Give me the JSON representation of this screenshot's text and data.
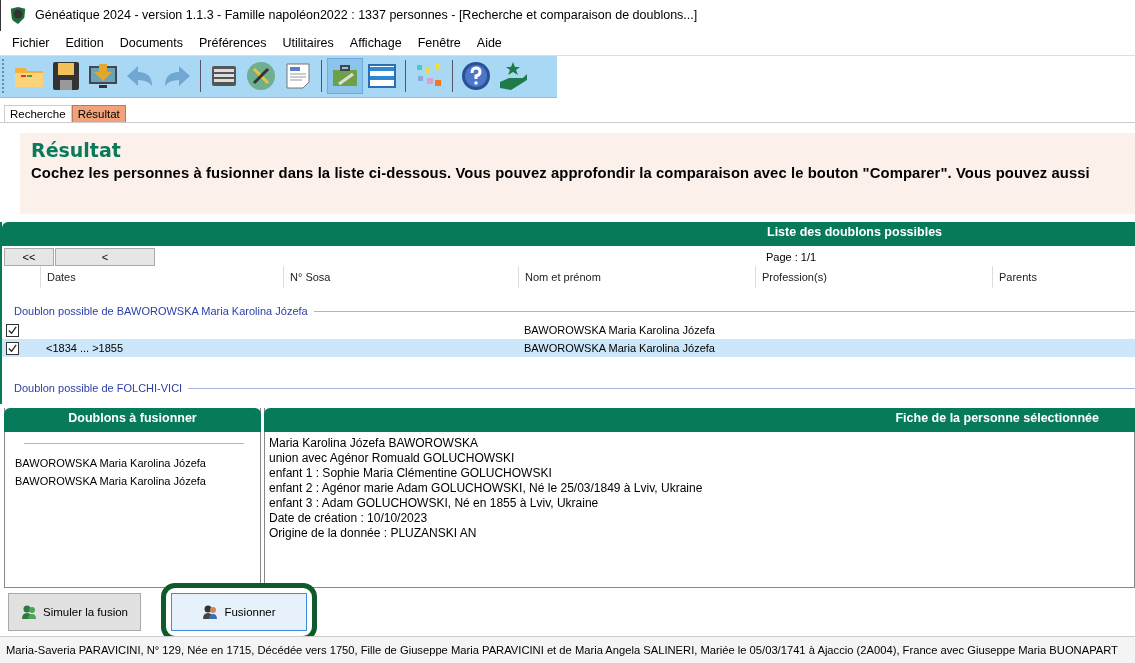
{
  "window": {
    "title": "Généatique 2024 - version 1.1.3 - Famille napoléon2022 : 1337 personnes - [Recherche et comparaison de doublons...]"
  },
  "menu": [
    "Fichier",
    "Edition",
    "Documents",
    "Préférences",
    "Utilitaires",
    "Affichage",
    "Fenêtre",
    "Aide"
  ],
  "toolbar": [
    {
      "kind": "folder",
      "disabled": false,
      "selected": false
    },
    {
      "kind": "save",
      "disabled": false,
      "selected": false
    },
    {
      "kind": "import",
      "disabled": false,
      "selected": false
    },
    {
      "kind": "undo",
      "disabled": true,
      "selected": false
    },
    {
      "kind": "redo",
      "disabled": true,
      "selected": false
    },
    {
      "kind": "separator"
    },
    {
      "kind": "cards",
      "disabled": false,
      "selected": false
    },
    {
      "kind": "tools",
      "disabled": false,
      "selected": false
    },
    {
      "kind": "document",
      "disabled": false,
      "selected": false
    },
    {
      "kind": "separator"
    },
    {
      "kind": "toolbox",
      "disabled": false,
      "selected": true
    },
    {
      "kind": "windows",
      "disabled": false,
      "selected": false
    },
    {
      "kind": "separator"
    },
    {
      "kind": "mosaic",
      "disabled": false,
      "selected": false
    },
    {
      "kind": "separator"
    },
    {
      "kind": "help",
      "disabled": false,
      "selected": false
    },
    {
      "kind": "award",
      "disabled": false,
      "selected": false
    }
  ],
  "tabs": [
    {
      "label": "Recherche",
      "selected": false
    },
    {
      "label": "Résultat",
      "selected": true
    }
  ],
  "banner": {
    "title": "Résultat",
    "text": "Cochez les personnes à fusionner dans la liste ci-dessous.  Vous pouvez approfondir la comparaison avec le bouton  \"Comparer\".  Vous pouvez aussi"
  },
  "list": {
    "title": "Liste des doublons possibles",
    "nav": [
      "<<",
      "<"
    ],
    "page": "Page : 1/1",
    "columns": [
      "Dates",
      "N° Sosa",
      "Nom et prénom",
      "Profession(s)",
      "Parents"
    ],
    "groups": [
      {
        "label": "Doublon possible  de BAWOROWSKA Maria Karolina Józefa",
        "rows": [
          {
            "checked": true,
            "selected": false,
            "dates": "",
            "name": "BAWOROWSKA Maria Karolina Józefa"
          },
          {
            "checked": true,
            "selected": true,
            "dates": "<1834 ... >1855",
            "name": "BAWOROWSKA Maria Karolina Józefa"
          }
        ]
      },
      {
        "label": "Doublon possible  de FOLCHI-VICI"
      }
    ]
  },
  "merge_panel": {
    "title": "Doublons à fusionner",
    "items": [
      "BAWOROWSKA Maria Karolina Józefa",
      "BAWOROWSKA Maria Karolina Józefa"
    ]
  },
  "detail_panel": {
    "title": "Fiche de la personne sélectionnée",
    "lines": [
      "Maria Karolina Józefa BAWOROWSKA",
      "union  avec Agénor Romuald GOLUCHOWSKI",
      "enfant 1 : Sophie Maria Clémentine GOLUCHOWSKI",
      "enfant 2 : Agénor marie Adam GOLUCHOWSKI, Né le 25/03/1849 à Lviv, Ukraine",
      "enfant 3 : Adam GOLUCHOWSKI, Né en 1855 à Lviv, Ukraine",
      "Date de création : 10/10/2023",
      "Origine de la donnée : PLUZANSKI AN"
    ]
  },
  "buttons": [
    {
      "label": "Simuler la fusion",
      "kind": "simulate",
      "focused": false
    },
    {
      "label": "Fusionner",
      "kind": "merge",
      "focused": true
    }
  ],
  "status_bar": "Maria-Saveria PARAVICINI, N° 129, Née en 1715, Décédée vers 1750, Fille de Giuseppe Maria PARAVICINI et de Maria Angela SALINERI, Mariée le 05/03/1741 à Ajaccio (2A004), France avec Giuseppe Maria BUONAPART"
}
